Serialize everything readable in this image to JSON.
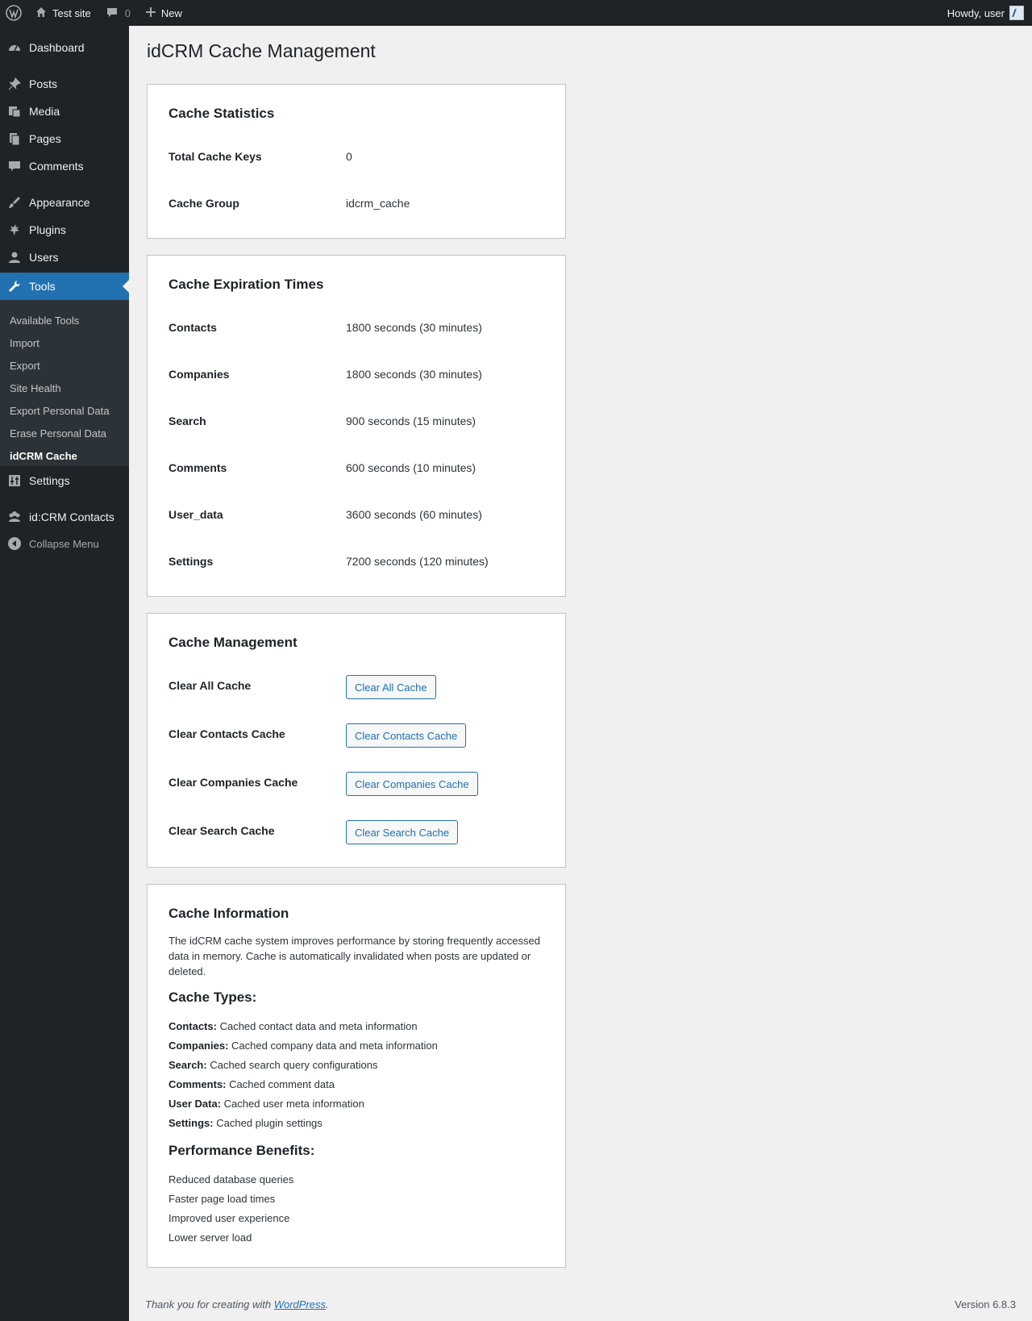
{
  "adminbar": {
    "site_name": "Test site",
    "comments_count": "0",
    "new_label": "New",
    "greeting": "Howdy, user"
  },
  "sidebar": {
    "items": [
      {
        "label": "Dashboard",
        "icon": "dashboard-icon"
      },
      {
        "label": "Posts",
        "icon": "pin-icon"
      },
      {
        "label": "Media",
        "icon": "media-icon"
      },
      {
        "label": "Pages",
        "icon": "pages-icon"
      },
      {
        "label": "Comments",
        "icon": "comment-icon"
      },
      {
        "label": "Appearance",
        "icon": "brush-icon"
      },
      {
        "label": "Plugins",
        "icon": "plug-icon"
      },
      {
        "label": "Users",
        "icon": "user-icon"
      },
      {
        "label": "Tools",
        "icon": "wrench-icon"
      },
      {
        "label": "Settings",
        "icon": "sliders-icon"
      },
      {
        "label": "id:CRM Contacts",
        "icon": "people-icon"
      }
    ],
    "tools_submenu": [
      "Available Tools",
      "Import",
      "Export",
      "Site Health",
      "Export Personal Data",
      "Erase Personal Data",
      "idCRM Cache"
    ],
    "collapse_label": "Collapse Menu"
  },
  "page": {
    "title": "idCRM Cache Management"
  },
  "stats": {
    "heading": "Cache Statistics",
    "rows": [
      {
        "label": "Total Cache Keys",
        "value": "0"
      },
      {
        "label": "Cache Group",
        "value": "idcrm_cache"
      }
    ]
  },
  "expiration": {
    "heading": "Cache Expiration Times",
    "rows": [
      {
        "label": "Contacts",
        "value": "1800 seconds (30 minutes)"
      },
      {
        "label": "Companies",
        "value": "1800 seconds (30 minutes)"
      },
      {
        "label": "Search",
        "value": "900 seconds (15 minutes)"
      },
      {
        "label": "Comments",
        "value": "600 seconds (10 minutes)"
      },
      {
        "label": "User_data",
        "value": "3600 seconds (60 minutes)"
      },
      {
        "label": "Settings",
        "value": "7200 seconds (120 minutes)"
      }
    ]
  },
  "management": {
    "heading": "Cache Management",
    "rows": [
      {
        "label": "Clear All Cache",
        "button": "Clear All Cache"
      },
      {
        "label": "Clear Contacts Cache",
        "button": "Clear Contacts Cache"
      },
      {
        "label": "Clear Companies Cache",
        "button": "Clear Companies Cache"
      },
      {
        "label": "Clear Search Cache",
        "button": "Clear Search Cache"
      }
    ]
  },
  "info": {
    "heading": "Cache Information",
    "description": "The idCRM cache system improves performance by storing frequently accessed data in memory. Cache is automatically invalidated when posts are updated or deleted.",
    "types_heading": "Cache Types:",
    "types": [
      {
        "name": "Contacts:",
        "desc": "Cached contact data and meta information"
      },
      {
        "name": "Companies:",
        "desc": "Cached company data and meta information"
      },
      {
        "name": "Search:",
        "desc": "Cached search query configurations"
      },
      {
        "name": "Comments:",
        "desc": "Cached comment data"
      },
      {
        "name": "User Data:",
        "desc": "Cached user meta information"
      },
      {
        "name": "Settings:",
        "desc": "Cached plugin settings"
      }
    ],
    "benefits_heading": "Performance Benefits:",
    "benefits": [
      "Reduced database queries",
      "Faster page load times",
      "Improved user experience",
      "Lower server load"
    ]
  },
  "footer": {
    "thanks_prefix": "Thank you for creating with ",
    "link_text": "WordPress",
    "thanks_suffix": ".",
    "version": "Version 6.8.3"
  }
}
